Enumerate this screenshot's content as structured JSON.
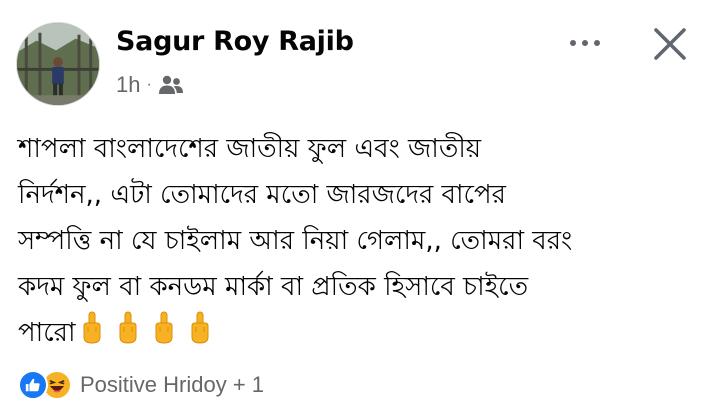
{
  "post": {
    "author_name": "Sagur Roy Rajib",
    "time": "1h",
    "separator": "·",
    "audience_icon": "friends-icon",
    "text": "শাপলা বাংলাদেশের জাতীয় ফুল এবং জাতীয়\nনির্দশন,, এটা তোমাদের মতো জারজদের বাপের\nসম্পত্তি না যে চাইলাম আর নিয়া গেলাম,, তোমরা বরং\nকদম ফুল বা কনডম মার্কা বা প্রতিক হিসাবে চাইতে\nপারো",
    "trailing_emoji": [
      "middle-finger-emoji",
      "middle-finger-emoji",
      "middle-finger-emoji",
      "middle-finger-emoji"
    ],
    "emoji_color": "#f7b125"
  },
  "header": {
    "more_icon": "more-horizontal-icon",
    "close_icon": "close-icon"
  },
  "reactions": {
    "icons": [
      "like-icon",
      "haha-icon"
    ],
    "summary": "Positive Hridoy + 1",
    "like_color": "#1877f2",
    "haha_color": "#f7b125"
  }
}
